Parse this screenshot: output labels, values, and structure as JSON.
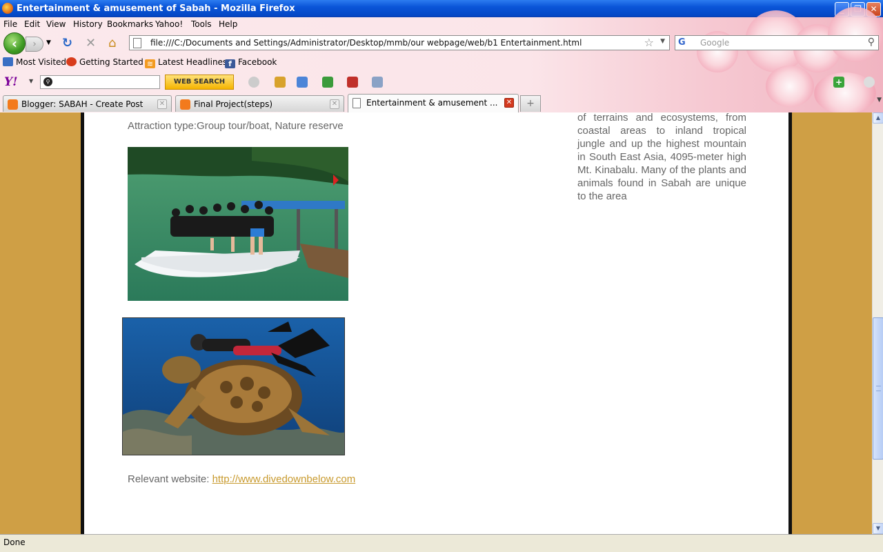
{
  "window": {
    "title": "Entertainment & amusement of Sabah - Mozilla Firefox",
    "controls": {
      "minimize": "_",
      "maximize": "❐",
      "close": "✕"
    }
  },
  "menu": [
    "File",
    "Edit",
    "View",
    "History",
    "Bookmarks",
    "Yahoo!",
    "Tools",
    "Help"
  ],
  "nav": {
    "url": "file:///C:/Documents and Settings/Administrator/Desktop/mmb/our webpage/web/b1 Entertainment.html",
    "search_placeholder": "Google"
  },
  "bookmarks": [
    {
      "label": "Most Visited",
      "icon": "folder-icon",
      "color": "#3a6fc4"
    },
    {
      "label": "Getting Started",
      "icon": "firefox-icon",
      "color": "#d83c1c"
    },
    {
      "label": "Latest Headlines",
      "icon": "rss-icon",
      "color": "#f39b21"
    },
    {
      "label": "Facebook",
      "icon": "facebook-icon",
      "color": "#3b5998"
    }
  ],
  "yahoo_toolbar": {
    "logo": "Y!",
    "search_button": "WEB SEARCH"
  },
  "tabs": [
    {
      "label": "Blogger: SABAH - Create Post",
      "icon": "blogger-icon",
      "active": false
    },
    {
      "label": "Final Project(steps)",
      "icon": "blogger-icon",
      "active": false
    },
    {
      "label": "Entertainment & amusement ...",
      "icon": "page-icon",
      "active": true
    }
  ],
  "page": {
    "attraction": "Attraction type:Group tour/boat, Nature reserve",
    "right_text": "of terrains and ecosystems, from coastal areas to inland tropical jungle and up the highest mountain in South East Asia, 4095-meter high Mt. Kinabalu. Many of the plants and animals found in Sabah are unique to the area",
    "relevant_label": "Relevant website: ",
    "relevant_link": "http://www.divedownbelow.com"
  },
  "status": "Done",
  "colors": {
    "page_background": "#cf9f45",
    "link": "#c89a2e",
    "text": "#666666"
  }
}
